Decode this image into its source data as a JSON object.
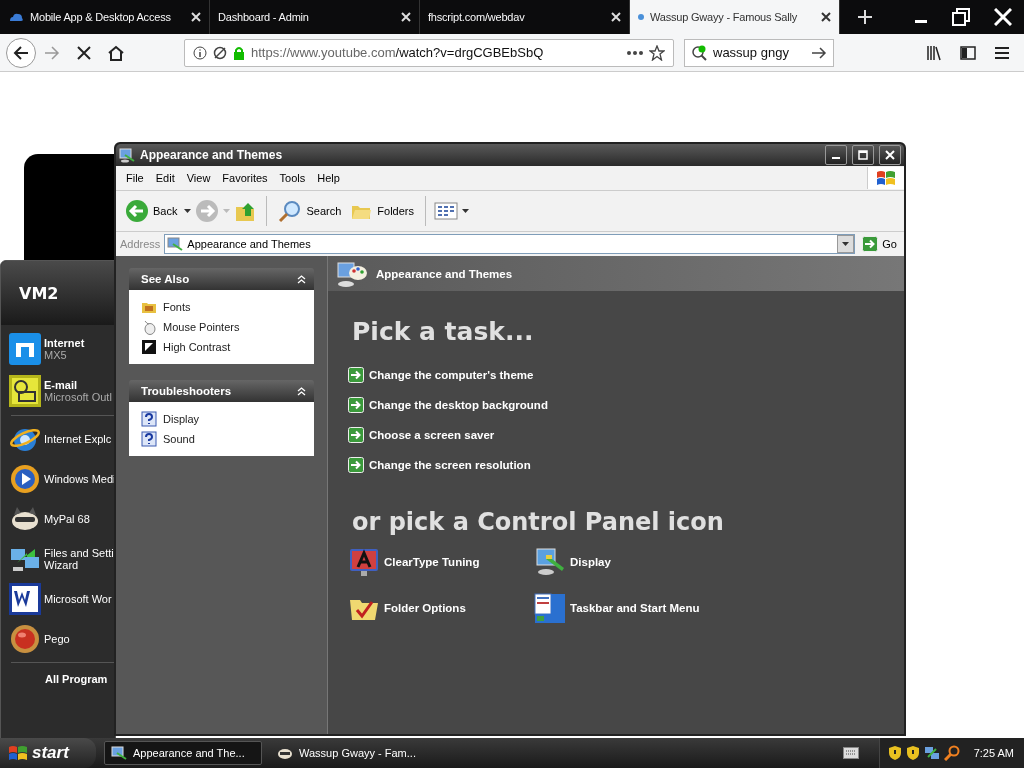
{
  "browser": {
    "tabs": [
      {
        "title": "Mobile App & Desktop Access",
        "selected": false
      },
      {
        "title": "Dashboard - Admin",
        "selected": false
      },
      {
        "title": "fhscript.com/webdav",
        "selected": false
      },
      {
        "title": "Wassup Gwayy - Famous Sally",
        "selected": true
      }
    ],
    "url_host": "https://www.youtube.com",
    "url_path": "/watch?v=drgCGBEbSbQ",
    "search_value": "wassup gngy"
  },
  "start_menu": {
    "user": "VM2",
    "items": [
      {
        "kind": "pinned",
        "title": "Internet",
        "subtitle": "MX5"
      },
      {
        "kind": "pinned",
        "title": "E-mail",
        "subtitle": "Microsoft Outl"
      },
      {
        "kind": "recent",
        "title": "Internet Explc"
      },
      {
        "kind": "recent",
        "title": "Windows Medi"
      },
      {
        "kind": "recent",
        "title": "MyPal 68"
      },
      {
        "kind": "recent",
        "title": "Files and Setti\nWizard"
      },
      {
        "kind": "recent",
        "title": "Microsoft Wor"
      },
      {
        "kind": "recent",
        "title": "Pego"
      }
    ],
    "all_programs": "All Program"
  },
  "window": {
    "title": "Appearance and Themes",
    "menu": [
      "File",
      "Edit",
      "View",
      "Favorites",
      "Tools",
      "Help"
    ],
    "toolbar": {
      "back": "Back",
      "search": "Search",
      "folders": "Folders"
    },
    "address_label": "Address",
    "address": "Appearance and Themes",
    "go": "Go",
    "panels": [
      {
        "title": "See Also",
        "expanded": true,
        "items": [
          "Fonts",
          "Mouse Pointers",
          "High Contrast"
        ]
      },
      {
        "title": "Troubleshooters",
        "expanded": true,
        "items": [
          "Display",
          "Sound"
        ]
      }
    ],
    "header": "Appearance and Themes",
    "task_heading": "Pick a task...",
    "tasks": [
      "Change the computer's theme",
      "Change the desktop background",
      "Choose a screen saver",
      "Change the screen resolution"
    ],
    "icon_heading": "or pick a Control Panel icon",
    "icons": [
      "ClearType Tuning",
      "Display",
      "Folder Options",
      "Taskbar and Start Menu"
    ]
  },
  "taskbar": {
    "start": "start",
    "buttons": [
      {
        "label": "Appearance and The...",
        "selected": true
      },
      {
        "label": "Wassup Gwayy - Fam...",
        "selected": false
      }
    ],
    "clock": "7:25 AM"
  }
}
